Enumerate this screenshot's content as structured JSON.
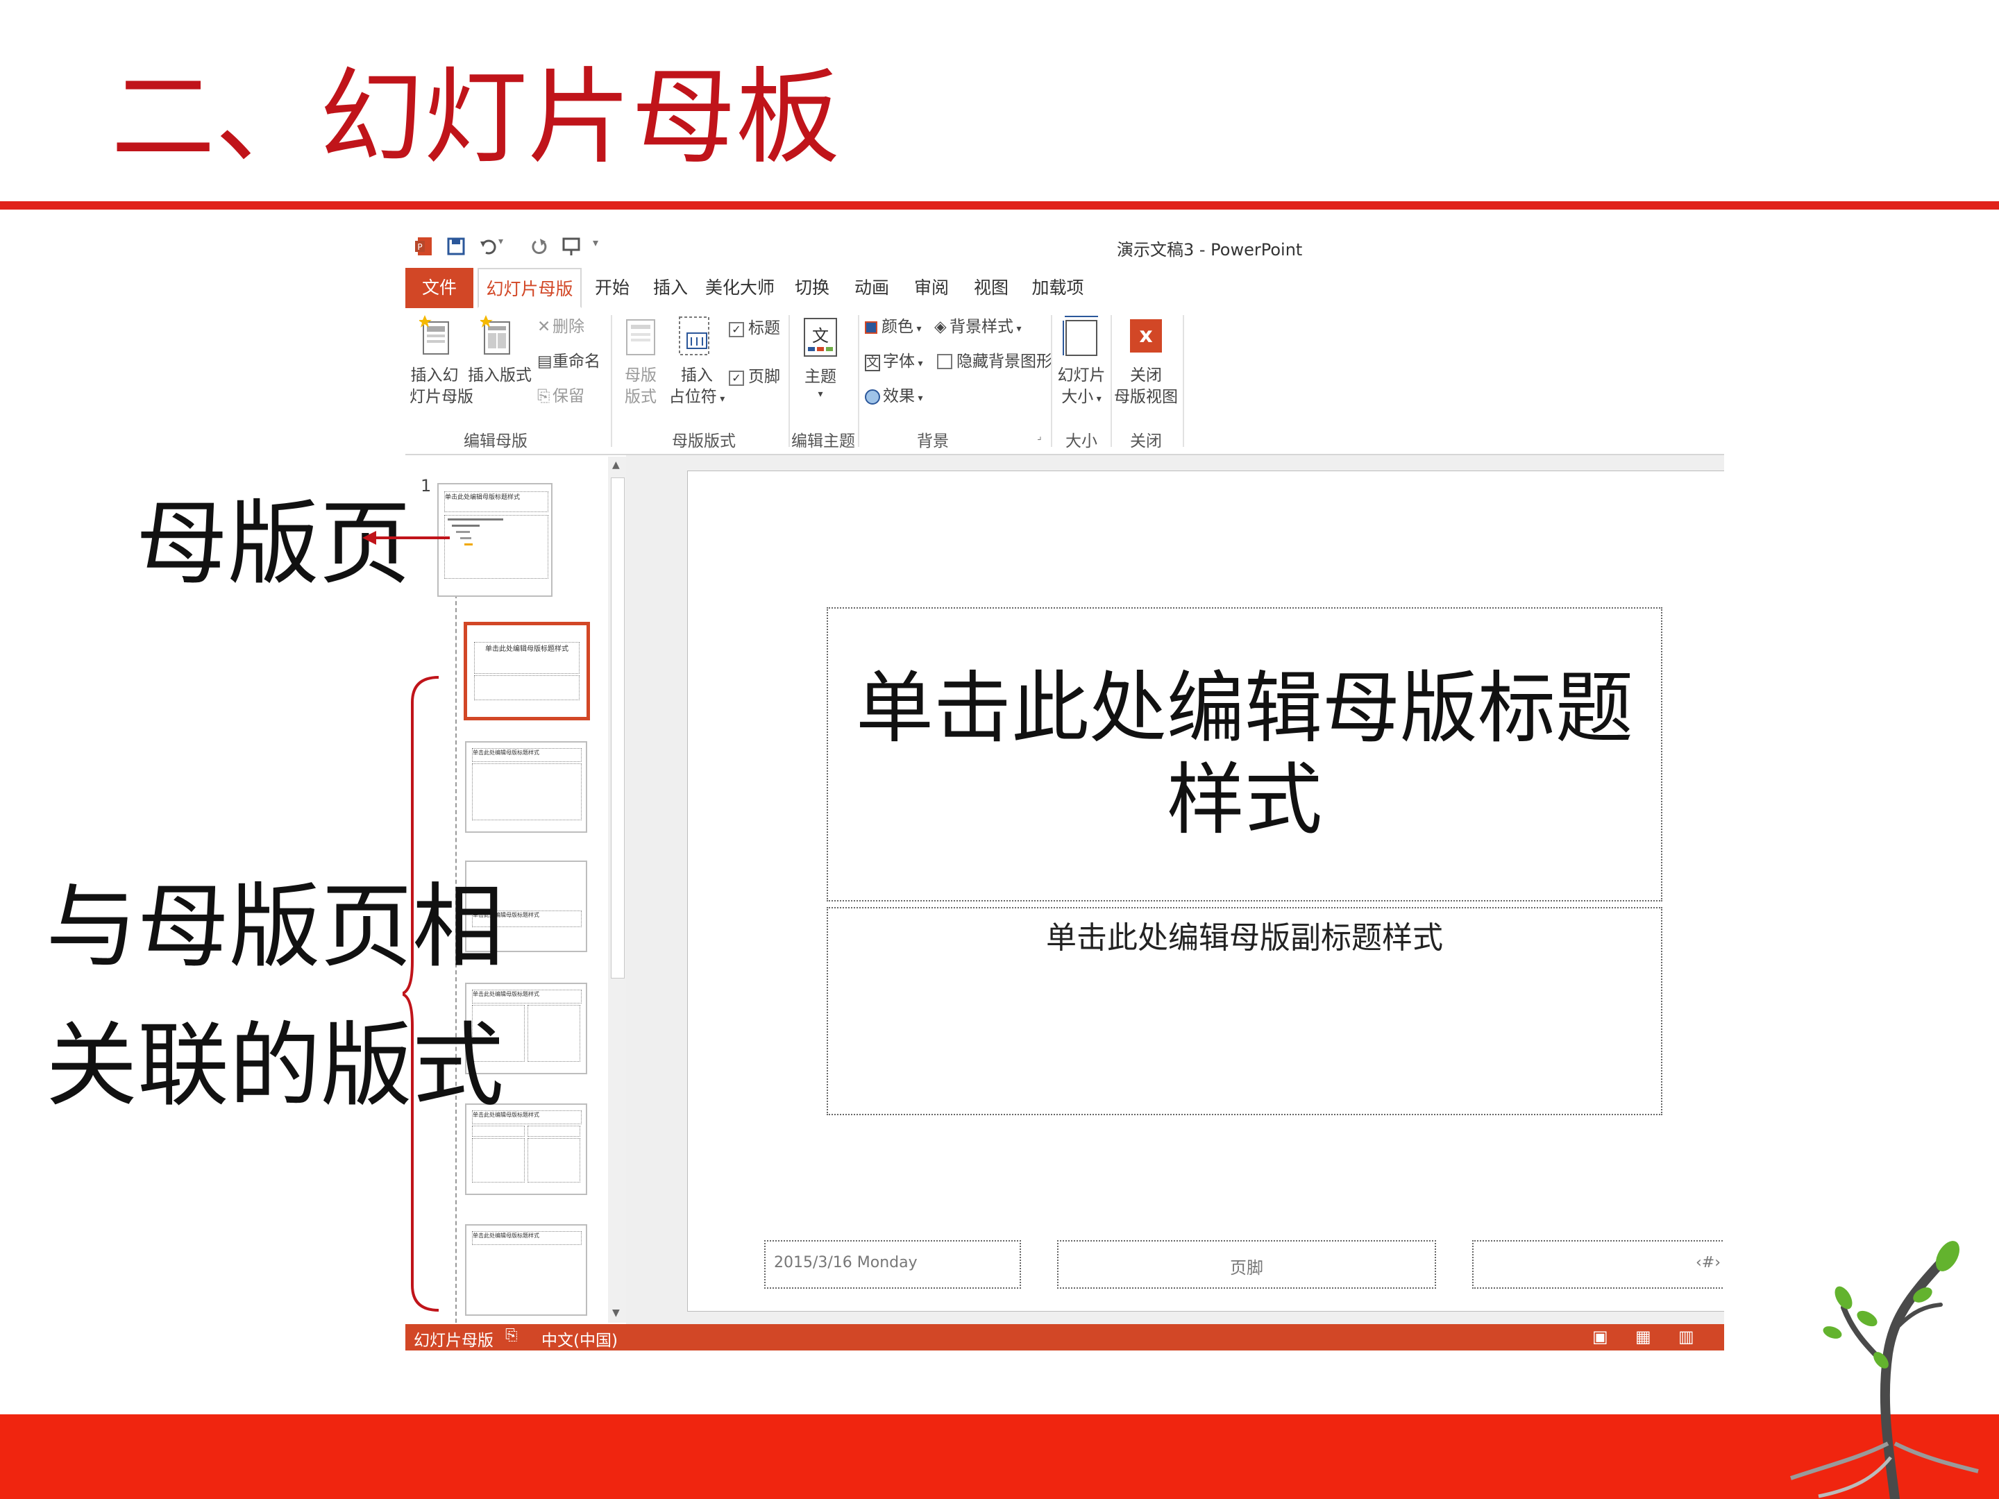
{
  "slide": {
    "title": "二、幻灯片母板",
    "callout_master": "母版页",
    "callout_layouts_line1": "与母版页相",
    "callout_layouts_line2": "关联的版式"
  },
  "window": {
    "title": "演示文稿3 - PowerPoint",
    "accent": "#d24726"
  },
  "tabs": [
    "文件",
    "幻灯片母版",
    "开始",
    "插入",
    "美化大师",
    "切换",
    "动画",
    "审阅",
    "视图",
    "加载项"
  ],
  "ribbon": {
    "edit_master": {
      "insert_master_l1": "插入幻",
      "insert_master_l2": "灯片母版",
      "insert_layout": "插入版式",
      "delete": "删除",
      "rename": "重命名",
      "preserve": "保留",
      "group_label": "编辑母版"
    },
    "master_layout": {
      "master_layout_l1": "母版",
      "master_layout_l2": "版式",
      "insert_placeholder_l1": "插入",
      "insert_placeholder_l2": "占位符",
      "title_checkbox": "标题",
      "footer_checkbox": "页脚",
      "group_label": "母版版式"
    },
    "edit_theme": {
      "themes": "主题",
      "group_label": "编辑主题"
    },
    "background": {
      "colors": "颜色",
      "fonts": "字体",
      "effects": "效果",
      "background_styles": "背景样式",
      "hide_background_graphics": "隐藏背景图形",
      "group_label": "背景"
    },
    "size": {
      "slide_size_l1": "幻灯片",
      "slide_size_l2": "大小",
      "group_label": "大小"
    },
    "close": {
      "close_l1": "关闭",
      "close_l2": "母版视图",
      "group_label": "关闭"
    }
  },
  "thumbnails": {
    "master_number": "1",
    "master_title": "单击此处编辑母版标题样式",
    "layout_title": "单击此处编辑母版标题样式"
  },
  "editor": {
    "title_placeholder": "单击此处编辑母版标题样式",
    "subtitle_placeholder": "单击此处编辑母版副标题样式",
    "date": "2015/3/16 Monday",
    "footer": "页脚",
    "slide_number": "‹#›"
  },
  "statusbar": {
    "view_name": "幻灯片母版",
    "language": "中文(中国)"
  }
}
